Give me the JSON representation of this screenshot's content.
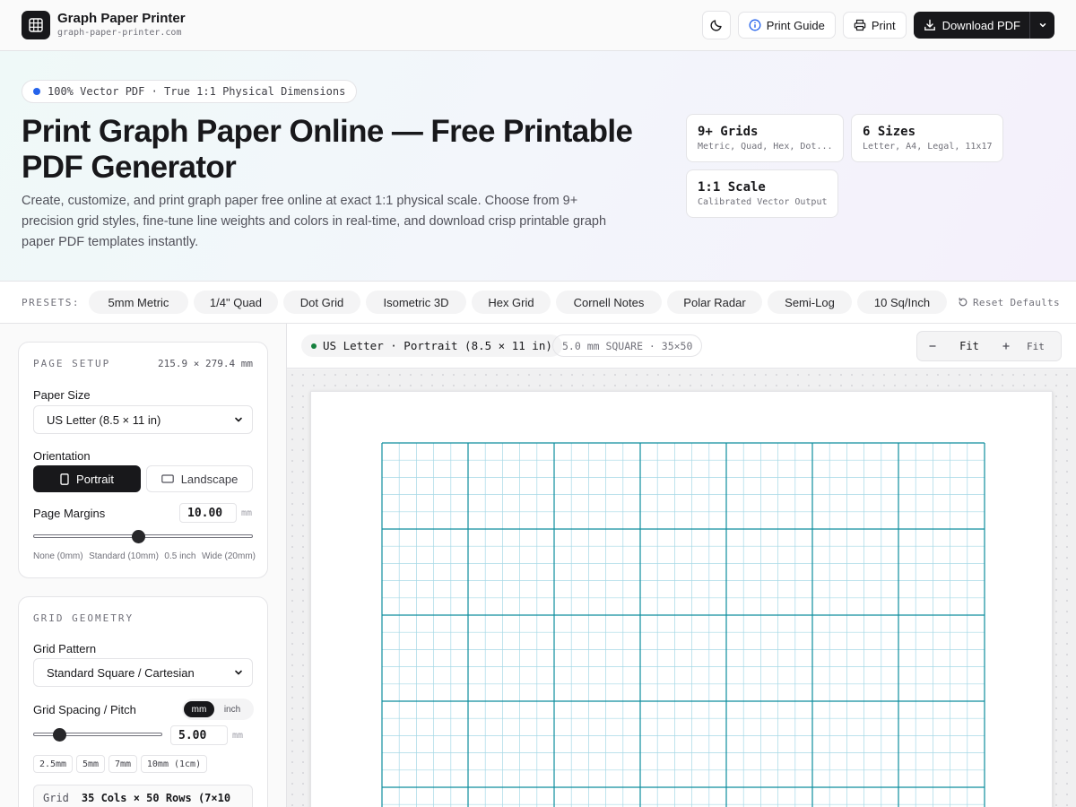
{
  "header": {
    "brand_name": "Graph Paper Printer",
    "brand_url": "graph-paper-printer.com",
    "print_guide_label": "Print Guide",
    "print_label": "Print",
    "download_label": "Download PDF"
  },
  "hero": {
    "badge": "100% Vector PDF · True 1:1 Physical Dimensions",
    "title": "Print Graph Paper Online — Free Printable PDF Generator",
    "description": "Create, customize, and print graph paper free online at exact 1:1 physical scale. Choose from 9+ precision grid styles, fine-tune line weights and colors in real-time, and download crisp printable graph paper PDF templates instantly.",
    "stats": [
      {
        "title": "9+ Grids",
        "sub": "Metric, Quad, Hex, Dot..."
      },
      {
        "title": "6 Sizes",
        "sub": "Letter, A4, Legal, 11x17"
      },
      {
        "title": "1:1 Scale",
        "sub": "Calibrated Vector Output"
      }
    ]
  },
  "presets": {
    "label": "PRESETS:",
    "items": [
      "5mm Metric",
      "1/4\" Quad",
      "Dot Grid",
      "Isometric 3D",
      "Hex Grid",
      "Cornell Notes",
      "Polar Radar",
      "Semi-Log",
      "10 Sq/Inch"
    ],
    "reset_label": "Reset Defaults"
  },
  "page_setup": {
    "title": "PAGE SETUP",
    "dimensions": "215.9 × 279.4 mm",
    "paper_size_label": "Paper Size",
    "paper_size_value": "US Letter (8.5 × 11 in)",
    "orientation_label": "Orientation",
    "portrait_label": "Portrait",
    "landscape_label": "Landscape",
    "orientation_selected": "Portrait",
    "margins_label": "Page Margins",
    "margins_value": "10.00",
    "margins_unit": "mm",
    "margins_fraction": 0.5,
    "margin_ticks": [
      "None (0mm)",
      "Standard (10mm)",
      "0.5 inch",
      "Wide (20mm)"
    ]
  },
  "grid_geometry": {
    "title": "GRID GEOMETRY",
    "pattern_label": "Grid Pattern",
    "pattern_value": "Standard Square / Cartesian",
    "spacing_label": "Grid Spacing / Pitch",
    "unit_mm": "mm",
    "unit_inch": "inch",
    "unit_selected": "mm",
    "spacing_value": "5.00",
    "spacing_unit": "mm",
    "spacing_fraction": 0.17,
    "quick_values": [
      "2.5mm",
      "5mm",
      "7mm",
      "10mm (1cm)"
    ],
    "grid_info_label": "Grid",
    "grid_info_value": "35 Cols × 50 Rows (7×10"
  },
  "preview": {
    "paper_chip": "US Letter · Portrait (8.5 × 11 in)",
    "grid_chip": "5.0 mm SQUARE · 35×50",
    "zoom_label": "Fit",
    "fit_label": "Fit",
    "grid_columns": 35,
    "grid_rows": 50,
    "major_every": 5,
    "minor_color": "#a5d8e6",
    "major_color": "#0e8e9e"
  },
  "colors": {
    "accent_dark": "#18181b",
    "badge_dot": "#2563eb",
    "status_dot": "#15803d"
  }
}
